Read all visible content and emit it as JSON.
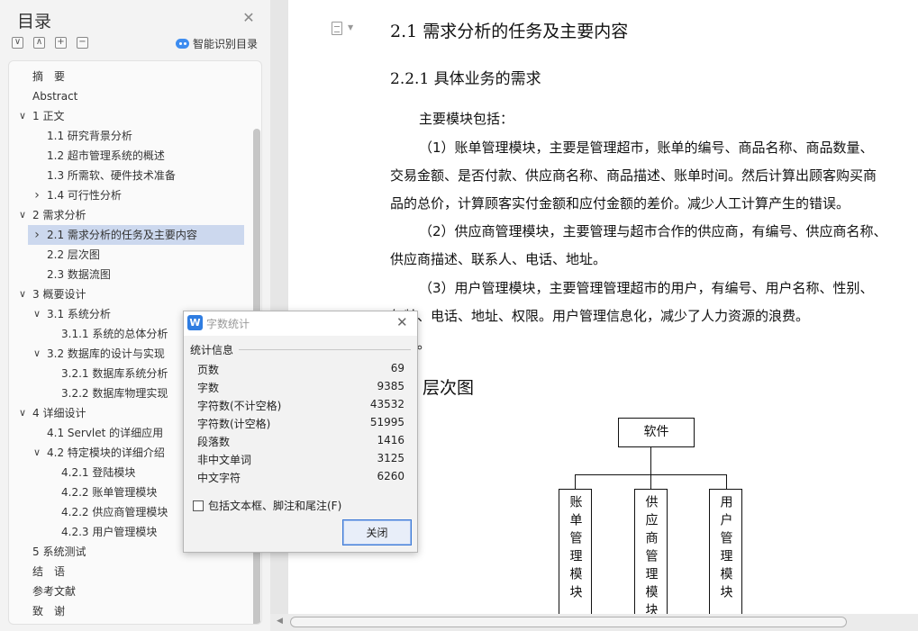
{
  "toc": {
    "title": "目录",
    "smart_label": "智能识别目录",
    "tools": [
      "∨",
      "∧",
      "+",
      "−"
    ],
    "items": [
      {
        "label": "摘　要",
        "level": 0,
        "chev": ""
      },
      {
        "label": "Abstract",
        "level": 0,
        "chev": ""
      },
      {
        "label": "1 正文",
        "level": 0,
        "chev": "down"
      },
      {
        "label": "1.1 研究背景分析",
        "level": 1,
        "chev": ""
      },
      {
        "label": "1.2  超市管理系统的概述",
        "level": 1,
        "chev": ""
      },
      {
        "label": "1.3 所需软、硬件技术准备",
        "level": 1,
        "chev": ""
      },
      {
        "label": "1.4 可行性分析",
        "level": 1,
        "chev": "right"
      },
      {
        "label": "2  需求分析",
        "level": 0,
        "chev": "down"
      },
      {
        "label": "2.1  需求分析的任务及主要内容",
        "level": 1,
        "chev": "right",
        "active": true
      },
      {
        "label": "2.2  层次图",
        "level": 1,
        "chev": ""
      },
      {
        "label": "2.3 数据流图",
        "level": 1,
        "chev": ""
      },
      {
        "label": "3  概要设计",
        "level": 0,
        "chev": "down"
      },
      {
        "label": "3.1    系统分析",
        "level": 1,
        "chev": "down"
      },
      {
        "label": "3.1.1  系统的总体分析",
        "level": 2,
        "chev": ""
      },
      {
        "label": "3.2  数据库的设计与实现",
        "level": 1,
        "chev": "down"
      },
      {
        "label": "3.2.1  数据库系统分析",
        "level": 2,
        "chev": ""
      },
      {
        "label": "3.2.2  数据库物理实现",
        "level": 2,
        "chev": ""
      },
      {
        "label": "4  详细设计",
        "level": 0,
        "chev": "down"
      },
      {
        "label": "4.1 Servlet 的详细应用",
        "level": 1,
        "chev": ""
      },
      {
        "label": "4.2  特定模块的详细介绍",
        "level": 1,
        "chev": "down"
      },
      {
        "label": "4.2.1  登陆模块",
        "level": 2,
        "chev": ""
      },
      {
        "label": "4.2.2  账单管理模块",
        "level": 2,
        "chev": ""
      },
      {
        "label": "4.2.2  供应商管理模块",
        "level": 2,
        "chev": ""
      },
      {
        "label": "4.2.3  用户管理模块",
        "level": 2,
        "chev": ""
      },
      {
        "label": "5  系统测试",
        "level": 0,
        "chev": ""
      },
      {
        "label": "结　语",
        "level": 0,
        "chev": ""
      },
      {
        "label": "参考文献",
        "level": 0,
        "chev": ""
      },
      {
        "label": "致　谢",
        "level": 0,
        "chev": ""
      }
    ]
  },
  "doc": {
    "h2": "2.1  需求分析的任务及主要内容",
    "h3": "2.2.1  具体业务的需求",
    "lines": [
      "主要模块包括：",
      "（1）账单管理模块，主要是管理超市，账单的编号、商品名称、商品数量、",
      "交易金额、是否付款、供应商名称、商品描述、账单时间。然后计算出顾客购买商",
      "品的总价，计算顾客实付金额和应付金额的差价。减少人工计算产生的错误。",
      "（2）供应商管理模块，主要管理与超市合作的供应商，有编号、供应商名称、",
      "供应商描述、联系人、电话、地址。",
      "（3）用户管理模块，主要管理管理超市的用户，有编号、用户名称、性别、",
      "年龄、电话、地址、权限。用户管理信息化，减少了人力资源的浪费。",
      "。"
    ],
    "h3b": "层次图",
    "diagram": {
      "root": "软件",
      "children": [
        "账单管理模块",
        "供应商管理模块",
        "用户管理模块"
      ]
    }
  },
  "dialog": {
    "title": "字数统计",
    "app_icon": "W",
    "section": "统计信息",
    "stats": [
      {
        "label": "页数",
        "value": "69"
      },
      {
        "label": "字数",
        "value": "9385"
      },
      {
        "label": "字符数(不计空格)",
        "value": "43532"
      },
      {
        "label": "字符数(计空格)",
        "value": "51995"
      },
      {
        "label": "段落数",
        "value": "1416"
      },
      {
        "label": "非中文单词",
        "value": "3125"
      },
      {
        "label": "中文字符",
        "value": "6260"
      }
    ],
    "checkbox_label": "包括文本框、脚注和尾注(F)",
    "close_button": "关闭"
  }
}
